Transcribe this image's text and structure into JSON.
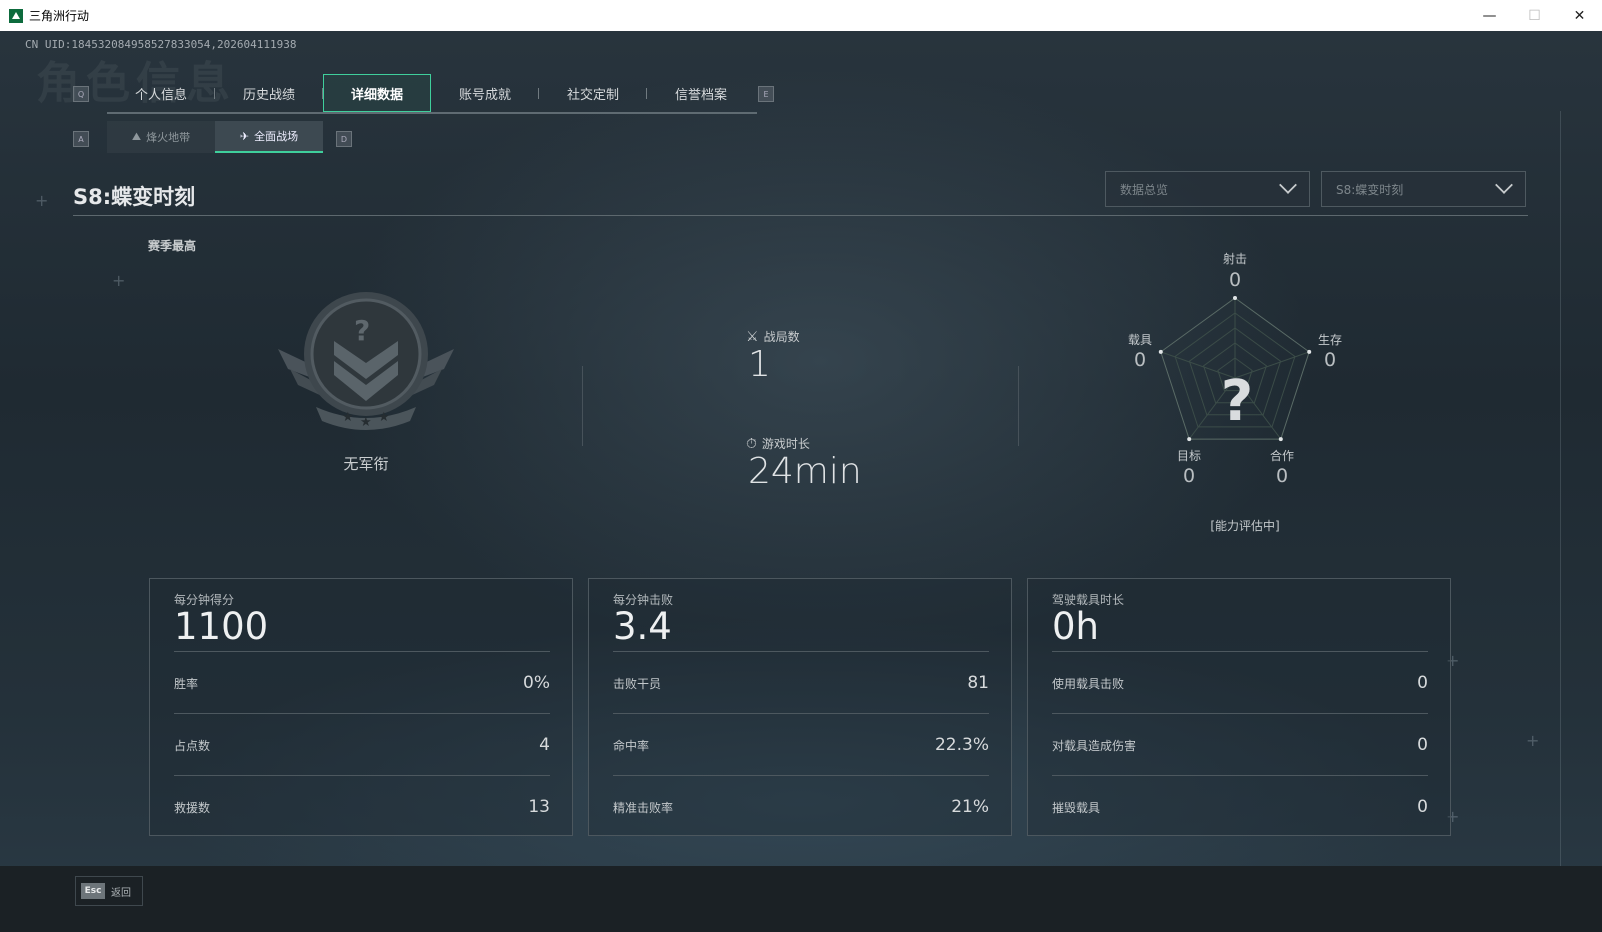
{
  "window": {
    "title": "三角洲行动",
    "minimize_glyph": "—",
    "maximize_glyph": "☐",
    "close_glyph": "✕"
  },
  "uid_text": "CN UID:184532084958527833054,202604111938",
  "bg_watermark": "角色信息",
  "tabs": {
    "left_key": "Q",
    "right_key": "E",
    "items": [
      {
        "label": "个人信息"
      },
      {
        "label": "历史战绩"
      },
      {
        "label": "详细数据",
        "active": true
      },
      {
        "label": "账号成就"
      },
      {
        "label": "社交定制"
      },
      {
        "label": "信誉档案"
      }
    ]
  },
  "subtabs": {
    "left_key": "A",
    "right_key": "D",
    "items": [
      {
        "label": "烽火地带",
        "icon": "mountain-icon"
      },
      {
        "label": "全面战场",
        "icon": "battlefield-icon",
        "active": true
      }
    ]
  },
  "season": {
    "title": "S8:蝶变时刻"
  },
  "dropdowns": {
    "data_type": "数据总览",
    "season": "S8:蝶变时刻"
  },
  "season_best": {
    "label": "赛季最高",
    "rank_name": "无军衔",
    "rank_symbol": "?"
  },
  "summary": {
    "matches_label": "战局数",
    "matches_value": "1",
    "playtime_label": "游戏时长",
    "playtime_value": "24min"
  },
  "radar": {
    "center_symbol": "?",
    "note": "[能力评估中]",
    "axes": [
      {
        "label": "射击",
        "value": "0"
      },
      {
        "label": "生存",
        "value": "0"
      },
      {
        "label": "合作",
        "value": "0"
      },
      {
        "label": "目标",
        "value": "0"
      },
      {
        "label": "载具",
        "value": "0"
      }
    ]
  },
  "cards": [
    {
      "head_label": "每分钟得分",
      "head_value": "1100",
      "rows": [
        {
          "label": "胜率",
          "value": "0%"
        },
        {
          "label": "占点数",
          "value": "4"
        },
        {
          "label": "救援数",
          "value": "13"
        }
      ]
    },
    {
      "head_label": "每分钟击败",
      "head_value": "3.4",
      "rows": [
        {
          "label": "击败干员",
          "value": "81"
        },
        {
          "label": "命中率",
          "value": "22.3%"
        },
        {
          "label": "精准击败率",
          "value": "21%"
        }
      ]
    },
    {
      "head_label": "驾驶载具时长",
      "head_value": "0h",
      "rows": [
        {
          "label": "使用载具击败",
          "value": "0"
        },
        {
          "label": "对载具造成伤害",
          "value": "0"
        },
        {
          "label": "摧毁载具",
          "value": "0"
        }
      ]
    }
  ],
  "footer": {
    "esc_key": "Esc",
    "esc_label": "返回"
  },
  "colors": {
    "accent": "#3fcf9c",
    "background": "#1f2a32",
    "text": "#c8ccce"
  }
}
